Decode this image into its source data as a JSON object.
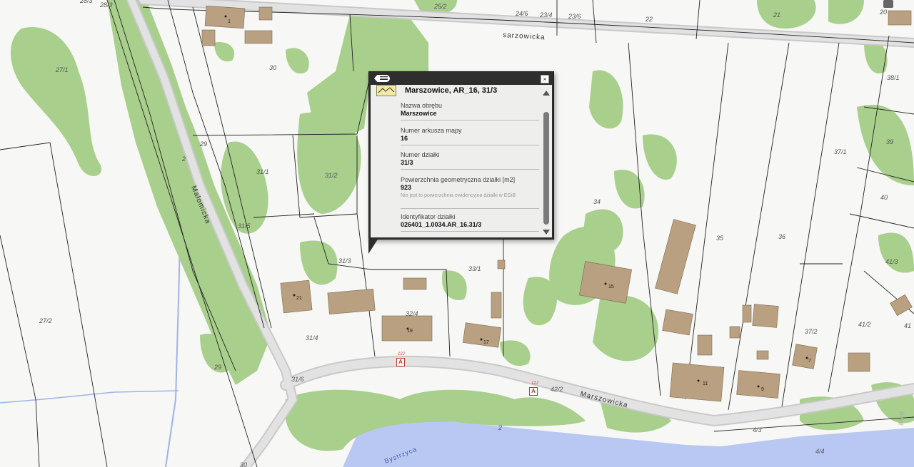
{
  "map": {
    "street_labels": {
      "marszowicka_top": "sarzowicka",
      "malomicka": "Małomicka",
      "marszowicka_bottom": "Marszowicka",
      "bystrzyca": "Bystrzyca"
    },
    "parcel_labels": [
      "28/3",
      "25/2",
      "24/6",
      "23/4",
      "23/6",
      "22",
      "21",
      "20",
      "1",
      "30",
      "27/1",
      "28",
      "38/1",
      "29",
      "2",
      "31/1",
      "31/2",
      "34",
      "37/1",
      "39",
      "40",
      "31/5",
      "31/3",
      "33/1",
      "35",
      "36",
      "41/3",
      "15",
      "21",
      "27/2",
      "32/4",
      "19",
      "17",
      "31/4",
      "37/2",
      "41/2",
      "7",
      "29",
      "31/6",
      "11",
      "9",
      "42/2",
      "4/3",
      "4/4",
      "30"
    ],
    "house_numbers": {
      "h1": "1",
      "h21": "21",
      "h19": "19",
      "h17": "17",
      "h15": "15",
      "h11": "11",
      "h9": "9",
      "h7": "7"
    },
    "address_markers": [
      {
        "label": "A",
        "sub": "12J"
      },
      {
        "label": "A",
        "sub": "12J"
      }
    ],
    "watermark": "iMap"
  },
  "popup": {
    "title": "Marszowice, AR_16, 31/3",
    "fields": [
      {
        "label": "Nazwa obrębu",
        "value": "Marszowice",
        "note": ""
      },
      {
        "label": "Numer arkusza mapy",
        "value": "16",
        "note": ""
      },
      {
        "label": "Numer działki",
        "value": "31/3",
        "note": ""
      },
      {
        "label": "Powierzchnia geometryczna działki [m2]",
        "value": "923",
        "note": "Nie jest to powierzchnia ewidencyjna działki w EGiB"
      },
      {
        "label": "Identyfikator działki",
        "value": "026401_1.0034.AR_16.31/3",
        "note": ""
      }
    ],
    "close_glyph": "×"
  },
  "colors": {
    "vegetation": "#a8cf8b",
    "building": "#b8a080",
    "road": "#d6d6d6",
    "water": "#b9c8f2",
    "parcel_line": "#222222"
  }
}
